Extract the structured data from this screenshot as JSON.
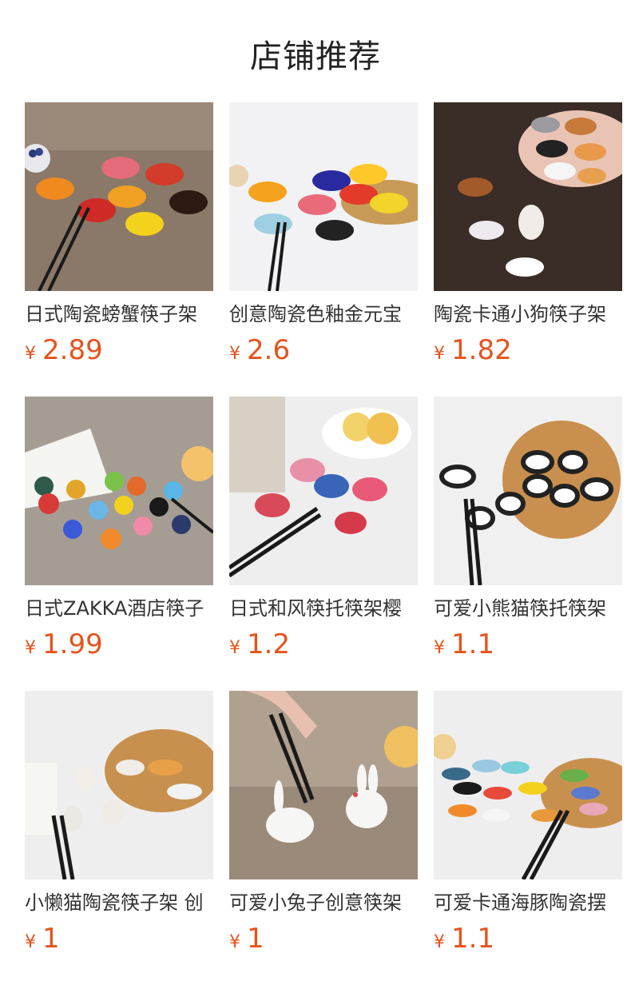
{
  "header": {
    "title": "店铺推荐"
  },
  "products": [
    {
      "name": "日式陶瓷螃蟹筷子架",
      "currency": "¥",
      "price": "2.89",
      "image": "ceramic-crab-chopstick-rests"
    },
    {
      "name": "创意陶瓷色釉金元宝",
      "currency": "¥",
      "price": "2.6",
      "image": "colored-glaze-ingot-rests"
    },
    {
      "name": "陶瓷卡通小狗筷子架",
      "currency": "¥",
      "price": "1.82",
      "image": "cartoon-dog-rests"
    },
    {
      "name": "日式ZAKKA酒店筷子",
      "currency": "¥",
      "price": "1.99",
      "image": "zakka-bird-rests"
    },
    {
      "name": "日式和风筷托筷架樱",
      "currency": "¥",
      "price": "1.2",
      "image": "wafu-floral-rests"
    },
    {
      "name": "可爱小熊猫筷托筷架",
      "currency": "¥",
      "price": "1.1",
      "image": "panda-rests"
    },
    {
      "name": "小懒猫陶瓷筷子架 创",
      "currency": "¥",
      "price": "1",
      "image": "lazy-cat-rests"
    },
    {
      "name": "可爱小兔子创意筷架",
      "currency": "¥",
      "price": "1",
      "image": "rabbit-rests"
    },
    {
      "name": "可爱卡通海豚陶瓷摆",
      "currency": "¥",
      "price": "1.1",
      "image": "dolphin-rests"
    }
  ]
}
